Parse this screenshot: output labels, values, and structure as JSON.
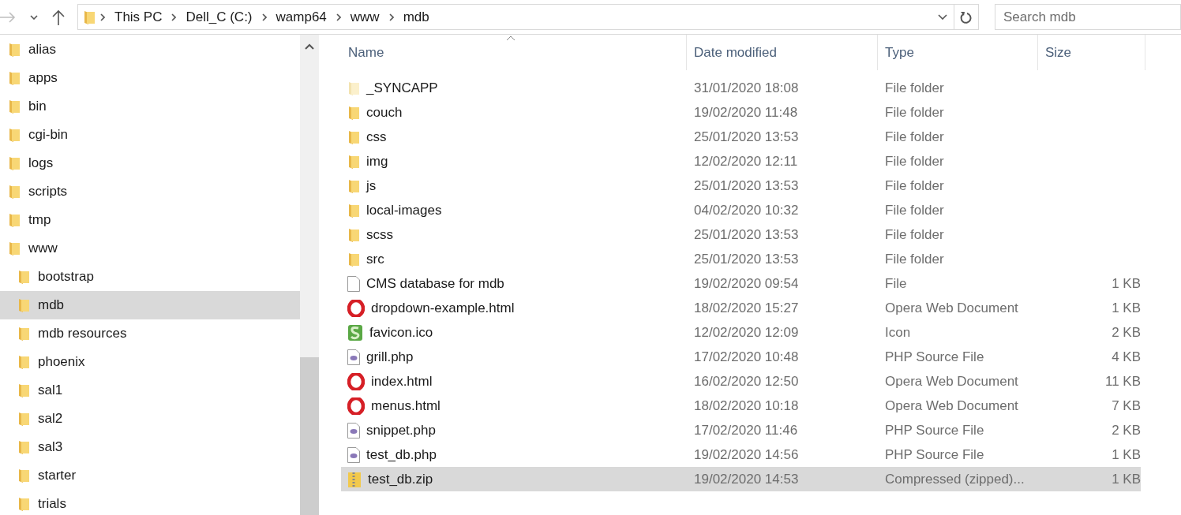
{
  "address_bar": {
    "crumbs": [
      "This PC",
      "Dell_C (C:)",
      "wamp64",
      "www",
      "mdb"
    ]
  },
  "search": {
    "placeholder": "Search mdb"
  },
  "sidebar": {
    "items": [
      {
        "label": "alias",
        "selected": false
      },
      {
        "label": "apps",
        "selected": false
      },
      {
        "label": "bin",
        "selected": false
      },
      {
        "label": "cgi-bin",
        "selected": false
      },
      {
        "label": "logs",
        "selected": false
      },
      {
        "label": "scripts",
        "selected": false
      },
      {
        "label": "tmp",
        "selected": false
      },
      {
        "label": "www",
        "selected": false,
        "children": [
          {
            "label": "bootstrap",
            "selected": false
          },
          {
            "label": "mdb",
            "selected": true
          },
          {
            "label": "mdb resources",
            "selected": false
          },
          {
            "label": "phoenix",
            "selected": false
          },
          {
            "label": "sal1",
            "selected": false
          },
          {
            "label": "sal2",
            "selected": false
          },
          {
            "label": "sal3",
            "selected": false
          },
          {
            "label": "starter",
            "selected": false
          },
          {
            "label": "trials",
            "selected": false
          }
        ]
      }
    ]
  },
  "table": {
    "columns": [
      "Name",
      "Date modified",
      "Type",
      "Size"
    ],
    "rows": [
      {
        "kind": "hidden-folder",
        "name": "_SYNCAPP",
        "date": "31/01/2020 18:08",
        "type": "File folder",
        "selected": false
      },
      {
        "kind": "folder",
        "name": "couch",
        "date": "19/02/2020 11:48",
        "type": "File folder",
        "selected": false
      },
      {
        "kind": "folder",
        "name": "css",
        "date": "25/01/2020 13:53",
        "type": "File folder",
        "selected": false
      },
      {
        "kind": "folder",
        "name": "img",
        "date": "12/02/2020 12:11",
        "type": "File folder",
        "selected": false
      },
      {
        "kind": "folder",
        "name": "js",
        "date": "25/01/2020 13:53",
        "type": "File folder",
        "selected": false
      },
      {
        "kind": "folder",
        "name": "local-images",
        "date": "04/02/2020 10:32",
        "type": "File folder",
        "selected": false
      },
      {
        "kind": "folder",
        "name": "scss",
        "date": "25/01/2020 13:53",
        "type": "File folder",
        "selected": false
      },
      {
        "kind": "folder",
        "name": "src",
        "date": "25/01/2020 13:53",
        "type": "File folder",
        "selected": false
      },
      {
        "kind": "file",
        "name": "CMS database for mdb",
        "date": "19/02/2020 09:54",
        "type": "File",
        "size": "1 KB",
        "selected": false
      },
      {
        "kind": "opera",
        "name": "dropdown-example.html",
        "date": "18/02/2020 15:27",
        "type": "Opera Web Document",
        "size": "1 KB",
        "selected": false
      },
      {
        "kind": "ico",
        "name": "favicon.ico",
        "date": "12/02/2020 12:09",
        "type": "Icon",
        "size": "2 KB",
        "selected": false
      },
      {
        "kind": "php",
        "name": "grill.php",
        "date": "17/02/2020 10:48",
        "type": "PHP Source File",
        "size": "4 KB",
        "selected": false
      },
      {
        "kind": "opera",
        "name": "index.html",
        "date": "16/02/2020 12:50",
        "type": "Opera Web Document",
        "size": "11 KB",
        "selected": false
      },
      {
        "kind": "opera",
        "name": "menus.html",
        "date": "18/02/2020 10:18",
        "type": "Opera Web Document",
        "size": "7 KB",
        "selected": false
      },
      {
        "kind": "php",
        "name": "snippet.php",
        "date": "17/02/2020 11:46",
        "type": "PHP Source File",
        "size": "2 KB",
        "selected": false
      },
      {
        "kind": "php",
        "name": "test_db.php",
        "date": "19/02/2020 14:56",
        "type": "PHP Source File",
        "size": "1 KB",
        "selected": false
      },
      {
        "kind": "zip",
        "name": "test_db.zip",
        "date": "19/02/2020 14:53",
        "type": "Compressed (zipped)...",
        "size": "1 KB",
        "selected": true
      }
    ]
  }
}
